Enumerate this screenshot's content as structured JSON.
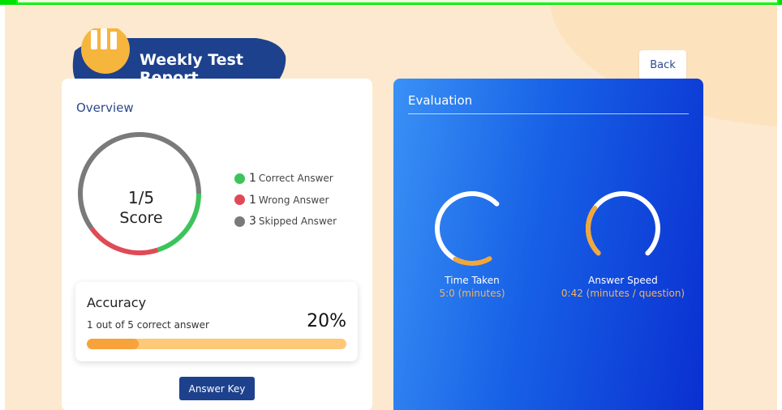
{
  "header": {
    "title": "Weekly Test Report",
    "back_label": "Back",
    "banner_color": "#1d418c",
    "logo_color": "#f6b53d"
  },
  "overview": {
    "title": "Overview",
    "score_value": "1/5",
    "score_label": "Score",
    "chart_data": {
      "type": "pie",
      "series": [
        {
          "name": "Correct Answer",
          "values": [
            1
          ],
          "color": "#3cc45b"
        },
        {
          "name": "Wrong Answer",
          "values": [
            1
          ],
          "color": "#e04a56"
        },
        {
          "name": "Skipped Answer",
          "values": [
            3
          ],
          "color": "#7a7a7a"
        }
      ]
    },
    "legend": [
      {
        "count": "1",
        "label": "Correct Answer",
        "color": "#3cc45b"
      },
      {
        "count": "1",
        "label": "Wrong Answer",
        "color": "#e04a56"
      },
      {
        "count": "3",
        "label": "Skipped Answer",
        "color": "#7a7a7a"
      }
    ],
    "accuracy": {
      "title": "Accuracy",
      "subtitle": "1 out of 5 correct answer",
      "percent_label": "20%",
      "percent_value": 0.2
    },
    "answer_key_label": "Answer Key"
  },
  "evaluation": {
    "title": "Evaluation",
    "time_taken": {
      "label": "Time Taken",
      "value": "5:0 (minutes)",
      "fill": 0.18
    },
    "answer_speed": {
      "label": "Answer Speed",
      "value": "0:42 (minutes / question)",
      "fill": 0.3
    }
  }
}
